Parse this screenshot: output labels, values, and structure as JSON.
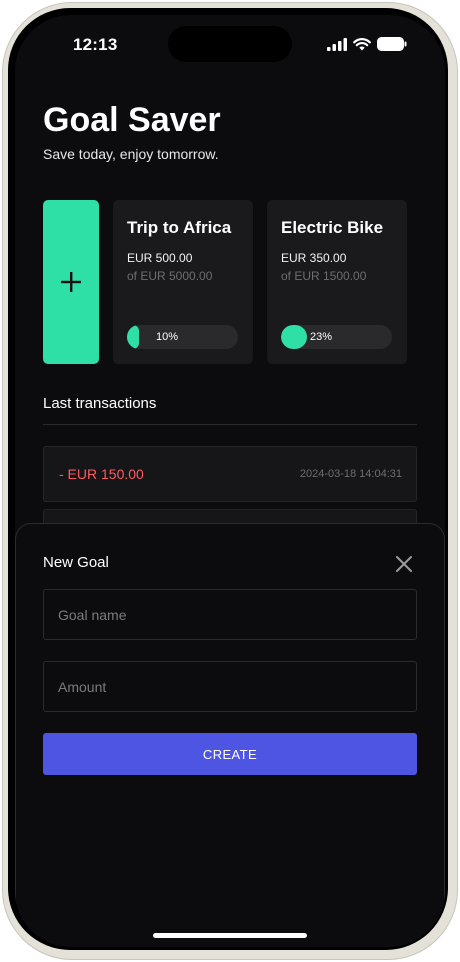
{
  "status_bar": {
    "time": "12:13"
  },
  "header": {
    "title": "Goal Saver",
    "subtitle": "Save today, enjoy tomorrow."
  },
  "add_goal": {
    "symbol": "+"
  },
  "goals": [
    {
      "title": "Trip to Africa",
      "saved": "EUR 500.00",
      "target": "of EUR 5000.00",
      "progress_label": "10%",
      "progress": 0.1
    },
    {
      "title": "Electric Bike",
      "saved": "EUR 350.00",
      "target": "of EUR 1500.00",
      "progress_label": "23%",
      "progress": 0.23
    }
  ],
  "transactions": {
    "title": "Last transactions",
    "items": [
      {
        "amount": "- EUR 150.00",
        "date": "2024-03-18 14:04:31"
      }
    ]
  },
  "new_goal_sheet": {
    "title": "New Goal",
    "name_placeholder": "Goal name",
    "amount_placeholder": "Amount",
    "create_label": "CREATE"
  },
  "colors": {
    "accent": "#2ee0a6",
    "primary_button": "#4f55e3",
    "negative": "#ff5a5f",
    "background": "#0c0c0e"
  }
}
